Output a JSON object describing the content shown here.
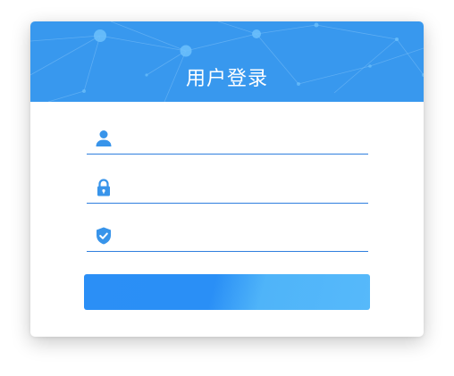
{
  "header": {
    "title": "用户登录",
    "background_color": "#3898ee"
  },
  "form": {
    "username": {
      "icon": "user-icon",
      "value": "",
      "placeholder": ""
    },
    "password": {
      "icon": "lock-icon",
      "value": "",
      "placeholder": ""
    },
    "captcha": {
      "icon": "shield-check-icon",
      "value": "",
      "placeholder": ""
    },
    "submit_label": ""
  },
  "colors": {
    "accent": "#3894ea",
    "underline": "#2f7fde",
    "button_start": "#2b8ff6",
    "button_end": "#56b9fa"
  }
}
